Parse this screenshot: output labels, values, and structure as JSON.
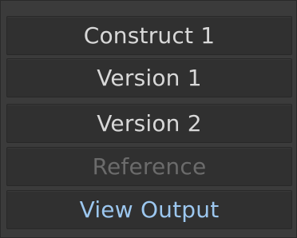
{
  "menu": {
    "items": [
      {
        "label": "Construct 1",
        "state": "normal"
      },
      {
        "label": "Version 1",
        "state": "normal"
      },
      {
        "label": "Version 2",
        "state": "normal"
      },
      {
        "label": "Reference",
        "state": "disabled"
      },
      {
        "label": "View Output",
        "state": "accent"
      }
    ]
  },
  "colors": {
    "panel_bg": "#3b3b3b",
    "button_bg": "#303030",
    "text_normal": "#d8d8d8",
    "text_disabled": "#6b6b6b",
    "text_accent": "#9cc7ef"
  }
}
